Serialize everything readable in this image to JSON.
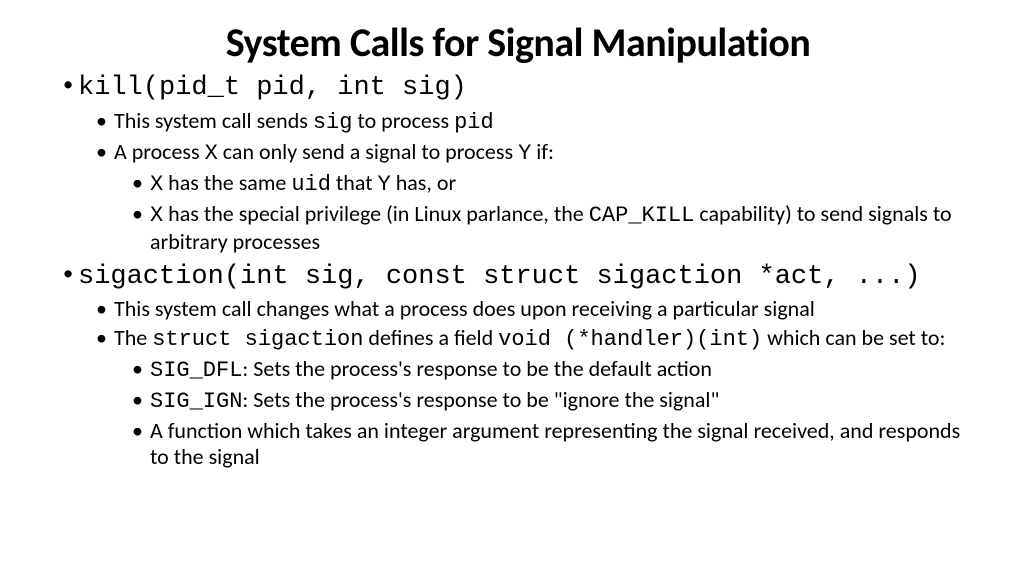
{
  "title": "System Calls for Signal Manipulation",
  "items": [
    {
      "lvl": 1,
      "code": true,
      "segs": [
        {
          "t": "kill(pid_t pid, int sig)",
          "m": 1
        }
      ]
    },
    {
      "lvl": 2,
      "segs": [
        {
          "t": "This system call sends "
        },
        {
          "t": "sig",
          "m": 1
        },
        {
          "t": " to process "
        },
        {
          "t": "pid",
          "m": 1
        }
      ]
    },
    {
      "lvl": 2,
      "segs": [
        {
          "t": "A process "
        },
        {
          "t": "X",
          "m": 1
        },
        {
          "t": " can only send a signal to process "
        },
        {
          "t": "Y",
          "m": 1
        },
        {
          "t": " if:"
        }
      ]
    },
    {
      "lvl": 3,
      "segs": [
        {
          "t": "X",
          "m": 1
        },
        {
          "t": " has the same "
        },
        {
          "t": "uid",
          "m": 1
        },
        {
          "t": " that "
        },
        {
          "t": "Y",
          "m": 1
        },
        {
          "t": " has, or"
        }
      ]
    },
    {
      "lvl": 3,
      "segs": [
        {
          "t": "X",
          "m": 1
        },
        {
          "t": " has the special privilege (in Linux parlance, the "
        },
        {
          "t": "CAP_KILL",
          "m": 1
        },
        {
          "t": " capability) to send signals to arbitrary processes"
        }
      ]
    },
    {
      "lvl": 1,
      "code": true,
      "segs": [
        {
          "t": "sigaction(int sig, const struct sigaction *act, ...)",
          "m": 1
        }
      ]
    },
    {
      "lvl": 2,
      "segs": [
        {
          "t": "This system call changes what a process does upon receiving a particular signal"
        }
      ]
    },
    {
      "lvl": 2,
      "segs": [
        {
          "t": "The "
        },
        {
          "t": "struct sigaction",
          "m": 1
        },
        {
          "t": " defines a field "
        },
        {
          "t": "void (*handler)(int)",
          "m": 1
        },
        {
          "t": " which can be set to:"
        }
      ]
    },
    {
      "lvl": 3,
      "segs": [
        {
          "t": "SIG_DFL",
          "m": 1
        },
        {
          "t": ": Sets the process's response to be the default action"
        }
      ]
    },
    {
      "lvl": 3,
      "segs": [
        {
          "t": "SIG_IGN",
          "m": 1
        },
        {
          "t": ": Sets the process's response to be \"ignore the signal\""
        }
      ]
    },
    {
      "lvl": 3,
      "segs": [
        {
          "t": "A function which takes an integer argument representing the signal received, and responds to the signal"
        }
      ]
    }
  ]
}
